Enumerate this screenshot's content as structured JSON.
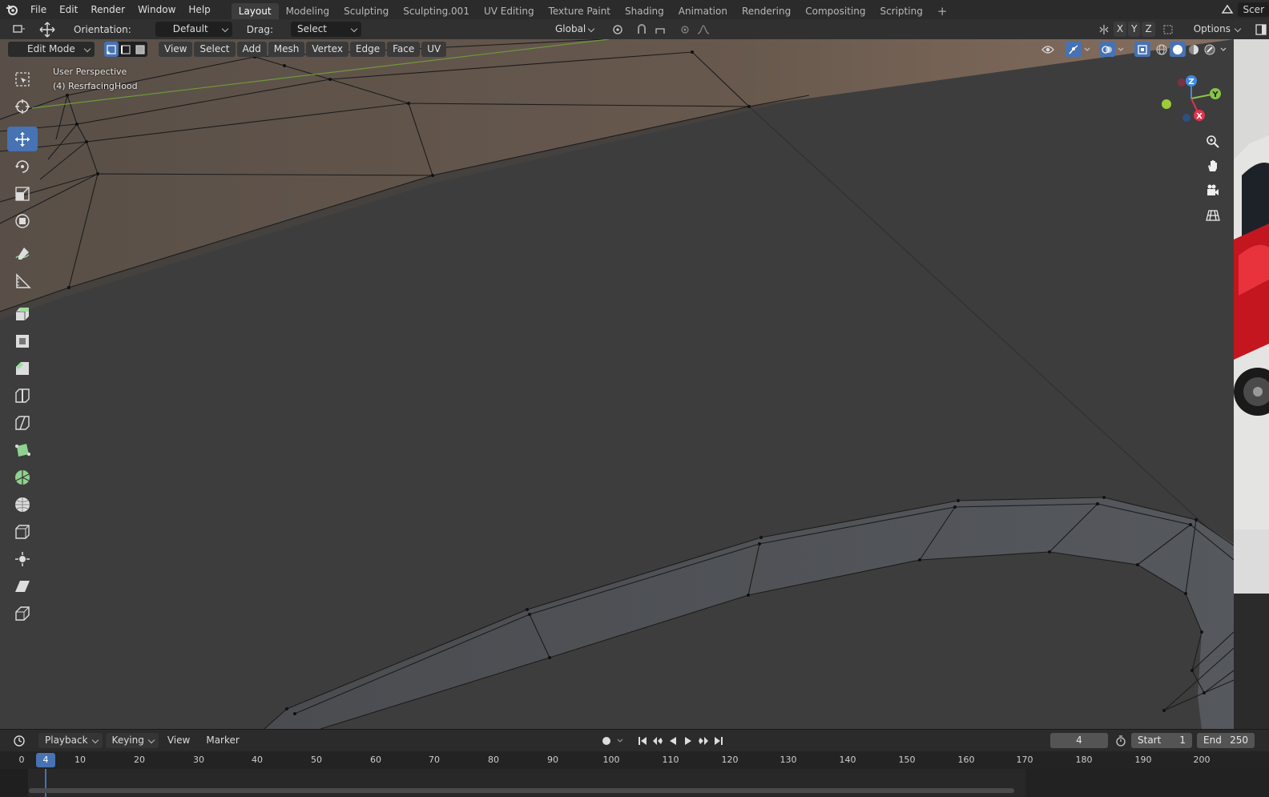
{
  "app": {
    "menus": [
      "File",
      "Edit",
      "Render",
      "Window",
      "Help"
    ],
    "workspaces": [
      "Layout",
      "Modeling",
      "Sculpting",
      "Sculpting.001",
      "UV Editing",
      "Texture Paint",
      "Shading",
      "Animation",
      "Rendering",
      "Compositing",
      "Scripting"
    ],
    "active_workspace": "Layout",
    "scene_label": "Scer"
  },
  "tool_header": {
    "orientation_label": "Orientation:",
    "orientation_value": "Default",
    "drag_label": "Drag:",
    "drag_value": "Select Box",
    "transform_orientation": "Global",
    "axis_x": "X",
    "axis_y": "Y",
    "axis_z": "Z",
    "options_label": "Options"
  },
  "mode_header": {
    "mode": "Edit Mode",
    "menus": [
      "View",
      "Select",
      "Add",
      "Mesh",
      "Vertex",
      "Edge",
      "Face",
      "UV"
    ]
  },
  "viewport": {
    "view_name": "User Perspective",
    "object_name": "(4) ResrfacingHood",
    "gizmo_x": "X",
    "gizmo_y": "Y",
    "gizmo_z": "Z"
  },
  "timeline": {
    "menus": [
      "Playback",
      "Keying",
      "View",
      "Marker"
    ],
    "current_frame": "4",
    "start_label": "Start",
    "start_value": "1",
    "end_label": "End",
    "end_value": "250",
    "ticks": [
      "0",
      "10",
      "20",
      "30",
      "40",
      "50",
      "60",
      "70",
      "80",
      "90",
      "100",
      "110",
      "120",
      "130",
      "140",
      "150",
      "160",
      "170",
      "180",
      "190",
      "200"
    ],
    "playhead_label": "4"
  },
  "colors": {
    "accent": "#4772b3",
    "gizmo_x": "#e8304a",
    "gizmo_y": "#8bc34a",
    "gizmo_z": "#3d8ae6"
  }
}
